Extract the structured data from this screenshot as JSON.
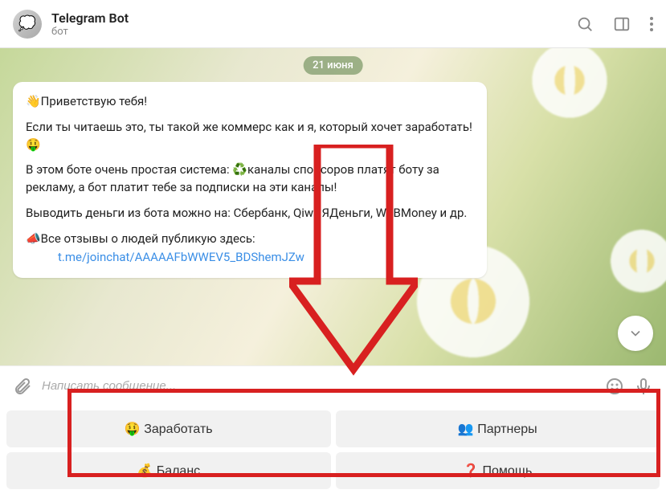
{
  "header": {
    "avatar_emoji": "💭",
    "title": "Telegram Bot",
    "subtitle": "бот"
  },
  "date_badge": "21 июня",
  "message": {
    "line1": "👋Приветствую тебя!",
    "line2": "Если ты читаешь это, ты такой же коммерс как и я, который хочет заработать!🤑",
    "line3": "В этом боте очень простая система: ♻️каналы спонсоров платят боту за рекламу, а бот платит тебе за подписки на эти каналы!",
    "line4": "Выводить деньги из бота можно на: Сбербанк, Qiwi, ЯДеньги, WEBMoney и др.",
    "line5": "📣Все отзывы о людей публикую здесь:",
    "link1": "t.me/joinchat/AAAAAFbWWEV5_BDShemJZw"
  },
  "input": {
    "placeholder": "Написать сообщение..."
  },
  "keyboard": {
    "btn1": "🤑 Заработать",
    "btn2": "👥 Партнеры",
    "btn3": "💰 Баланс",
    "btn4": "❓ Помощь"
  }
}
